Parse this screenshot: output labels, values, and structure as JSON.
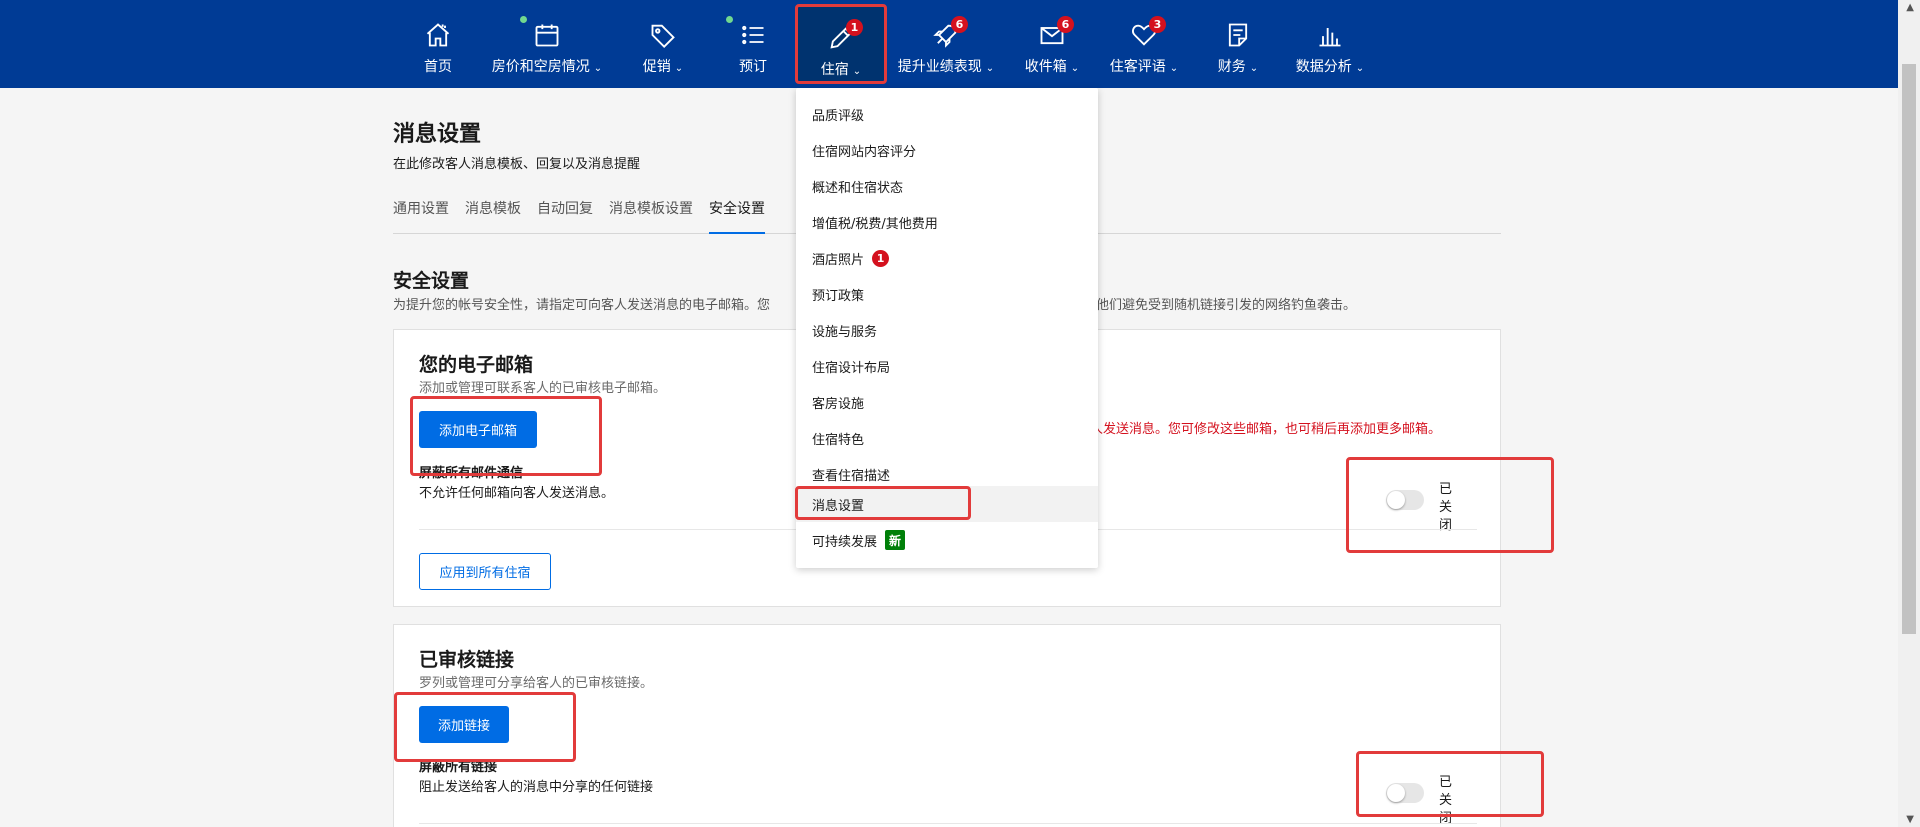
{
  "nav": {
    "items": [
      {
        "label": "首页",
        "chevron": "",
        "icon": "home-icon",
        "badge": "",
        "dot": false
      },
      {
        "label": "房价和空房情况",
        "chevron": "⌄",
        "icon": "calendar-icon",
        "badge": "",
        "dot": true
      },
      {
        "label": "促销",
        "chevron": "⌄",
        "icon": "tag-icon",
        "badge": "",
        "dot": false
      },
      {
        "label": "预订",
        "chevron": "",
        "icon": "list-icon",
        "badge": "",
        "dot": true
      },
      {
        "label": "住宿",
        "chevron": "⌄",
        "icon": "pencil-icon",
        "badge": "1",
        "dot": false
      },
      {
        "label": "提升业绩表现",
        "chevron": "⌄",
        "icon": "rocket-icon",
        "badge": "6",
        "dot": false
      },
      {
        "label": "收件箱",
        "chevron": "⌄",
        "icon": "envelope-icon",
        "badge": "6",
        "dot": false
      },
      {
        "label": "住客评语",
        "chevron": "⌄",
        "icon": "heart-icon",
        "badge": "3",
        "dot": false
      },
      {
        "label": "财务",
        "chevron": "⌄",
        "icon": "document-icon",
        "badge": "",
        "dot": false
      },
      {
        "label": "数据分析",
        "chevron": "⌄",
        "icon": "bar-chart-icon",
        "badge": "",
        "dot": false
      }
    ]
  },
  "page": {
    "title": "消息设置",
    "subtitle": "在此修改客人消息模板、回复以及消息提醒",
    "tabs": [
      "通用设置",
      "消息模板",
      "自动回复",
      "消息模板设置",
      "安全设置"
    ],
    "active_tab": "安全设置"
  },
  "security": {
    "title": "安全设置",
    "description": "为提升您的帐号安全性，请指定可向客人发送消息的电子邮箱。您",
    "description_tail": "帮助他们避免受到随机链接引发的网络钓鱼袭击。"
  },
  "email_card": {
    "title": "您的电子邮箱",
    "description": "添加或管理可联系客人的已审核电子邮箱。",
    "add_button": "添加电子邮箱",
    "warning": "人发送消息。您可修改这些邮箱，也可稍后再添加更多邮箱。",
    "block_title": "屏蔽所有邮件通信",
    "block_desc": "不允许任何邮箱向客人发送消息。",
    "toggle_label": "已关闭",
    "toggle_on": false,
    "apply_button": "应用到所有住宿"
  },
  "links_card": {
    "title": "已审核链接",
    "description": "罗列或管理可分享给客人的已审核链接。",
    "add_button": "添加链接",
    "block_title": "屏蔽所有链接",
    "block_desc": "阻止发送给客人的消息中分享的任何链接",
    "toggle_label": "已关闭",
    "toggle_on": false
  },
  "dropdown": {
    "items": [
      {
        "label": "品质评级",
        "badge": "",
        "tag": ""
      },
      {
        "label": "住宿网站内容评分",
        "badge": "",
        "tag": ""
      },
      {
        "label": "概述和住宿状态",
        "badge": "",
        "tag": ""
      },
      {
        "label": "增值税/税费/其他费用",
        "badge": "",
        "tag": ""
      },
      {
        "label": "酒店照片",
        "badge": "1",
        "tag": ""
      },
      {
        "label": "预订政策",
        "badge": "",
        "tag": ""
      },
      {
        "label": "设施与服务",
        "badge": "",
        "tag": ""
      },
      {
        "label": "住宿设计布局",
        "badge": "",
        "tag": ""
      },
      {
        "label": "客房设施",
        "badge": "",
        "tag": ""
      },
      {
        "label": "住宿特色",
        "badge": "",
        "tag": ""
      },
      {
        "label": "查看住宿描述",
        "badge": "",
        "tag": ""
      },
      {
        "label": "消息设置",
        "badge": "",
        "tag": ""
      },
      {
        "label": "可持续发展",
        "badge": "",
        "tag": "新"
      }
    ]
  },
  "colors": {
    "brand": "#003b95",
    "primary": "#006ce4",
    "danger": "#d4111e",
    "new_tag": "#008009",
    "annotation": "#e23b3b"
  }
}
